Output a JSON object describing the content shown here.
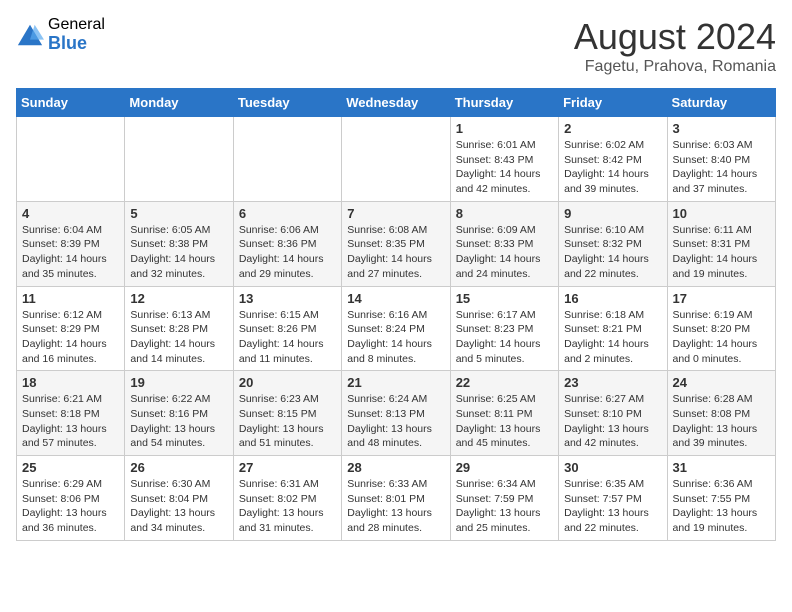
{
  "logo": {
    "general": "General",
    "blue": "Blue"
  },
  "title": {
    "month_year": "August 2024",
    "location": "Fagetu, Prahova, Romania"
  },
  "days_of_week": [
    "Sunday",
    "Monday",
    "Tuesday",
    "Wednesday",
    "Thursday",
    "Friday",
    "Saturday"
  ],
  "weeks": [
    [
      {
        "day": "",
        "info": ""
      },
      {
        "day": "",
        "info": ""
      },
      {
        "day": "",
        "info": ""
      },
      {
        "day": "",
        "info": ""
      },
      {
        "day": "1",
        "info": "Sunrise: 6:01 AM\nSunset: 8:43 PM\nDaylight: 14 hours and 42 minutes."
      },
      {
        "day": "2",
        "info": "Sunrise: 6:02 AM\nSunset: 8:42 PM\nDaylight: 14 hours and 39 minutes."
      },
      {
        "day": "3",
        "info": "Sunrise: 6:03 AM\nSunset: 8:40 PM\nDaylight: 14 hours and 37 minutes."
      }
    ],
    [
      {
        "day": "4",
        "info": "Sunrise: 6:04 AM\nSunset: 8:39 PM\nDaylight: 14 hours and 35 minutes."
      },
      {
        "day": "5",
        "info": "Sunrise: 6:05 AM\nSunset: 8:38 PM\nDaylight: 14 hours and 32 minutes."
      },
      {
        "day": "6",
        "info": "Sunrise: 6:06 AM\nSunset: 8:36 PM\nDaylight: 14 hours and 29 minutes."
      },
      {
        "day": "7",
        "info": "Sunrise: 6:08 AM\nSunset: 8:35 PM\nDaylight: 14 hours and 27 minutes."
      },
      {
        "day": "8",
        "info": "Sunrise: 6:09 AM\nSunset: 8:33 PM\nDaylight: 14 hours and 24 minutes."
      },
      {
        "day": "9",
        "info": "Sunrise: 6:10 AM\nSunset: 8:32 PM\nDaylight: 14 hours and 22 minutes."
      },
      {
        "day": "10",
        "info": "Sunrise: 6:11 AM\nSunset: 8:31 PM\nDaylight: 14 hours and 19 minutes."
      }
    ],
    [
      {
        "day": "11",
        "info": "Sunrise: 6:12 AM\nSunset: 8:29 PM\nDaylight: 14 hours and 16 minutes."
      },
      {
        "day": "12",
        "info": "Sunrise: 6:13 AM\nSunset: 8:28 PM\nDaylight: 14 hours and 14 minutes."
      },
      {
        "day": "13",
        "info": "Sunrise: 6:15 AM\nSunset: 8:26 PM\nDaylight: 14 hours and 11 minutes."
      },
      {
        "day": "14",
        "info": "Sunrise: 6:16 AM\nSunset: 8:24 PM\nDaylight: 14 hours and 8 minutes."
      },
      {
        "day": "15",
        "info": "Sunrise: 6:17 AM\nSunset: 8:23 PM\nDaylight: 14 hours and 5 minutes."
      },
      {
        "day": "16",
        "info": "Sunrise: 6:18 AM\nSunset: 8:21 PM\nDaylight: 14 hours and 2 minutes."
      },
      {
        "day": "17",
        "info": "Sunrise: 6:19 AM\nSunset: 8:20 PM\nDaylight: 14 hours and 0 minutes."
      }
    ],
    [
      {
        "day": "18",
        "info": "Sunrise: 6:21 AM\nSunset: 8:18 PM\nDaylight: 13 hours and 57 minutes."
      },
      {
        "day": "19",
        "info": "Sunrise: 6:22 AM\nSunset: 8:16 PM\nDaylight: 13 hours and 54 minutes."
      },
      {
        "day": "20",
        "info": "Sunrise: 6:23 AM\nSunset: 8:15 PM\nDaylight: 13 hours and 51 minutes."
      },
      {
        "day": "21",
        "info": "Sunrise: 6:24 AM\nSunset: 8:13 PM\nDaylight: 13 hours and 48 minutes."
      },
      {
        "day": "22",
        "info": "Sunrise: 6:25 AM\nSunset: 8:11 PM\nDaylight: 13 hours and 45 minutes."
      },
      {
        "day": "23",
        "info": "Sunrise: 6:27 AM\nSunset: 8:10 PM\nDaylight: 13 hours and 42 minutes."
      },
      {
        "day": "24",
        "info": "Sunrise: 6:28 AM\nSunset: 8:08 PM\nDaylight: 13 hours and 39 minutes."
      }
    ],
    [
      {
        "day": "25",
        "info": "Sunrise: 6:29 AM\nSunset: 8:06 PM\nDaylight: 13 hours and 36 minutes."
      },
      {
        "day": "26",
        "info": "Sunrise: 6:30 AM\nSunset: 8:04 PM\nDaylight: 13 hours and 34 minutes."
      },
      {
        "day": "27",
        "info": "Sunrise: 6:31 AM\nSunset: 8:02 PM\nDaylight: 13 hours and 31 minutes."
      },
      {
        "day": "28",
        "info": "Sunrise: 6:33 AM\nSunset: 8:01 PM\nDaylight: 13 hours and 28 minutes."
      },
      {
        "day": "29",
        "info": "Sunrise: 6:34 AM\nSunset: 7:59 PM\nDaylight: 13 hours and 25 minutes."
      },
      {
        "day": "30",
        "info": "Sunrise: 6:35 AM\nSunset: 7:57 PM\nDaylight: 13 hours and 22 minutes."
      },
      {
        "day": "31",
        "info": "Sunrise: 6:36 AM\nSunset: 7:55 PM\nDaylight: 13 hours and 19 minutes."
      }
    ]
  ]
}
